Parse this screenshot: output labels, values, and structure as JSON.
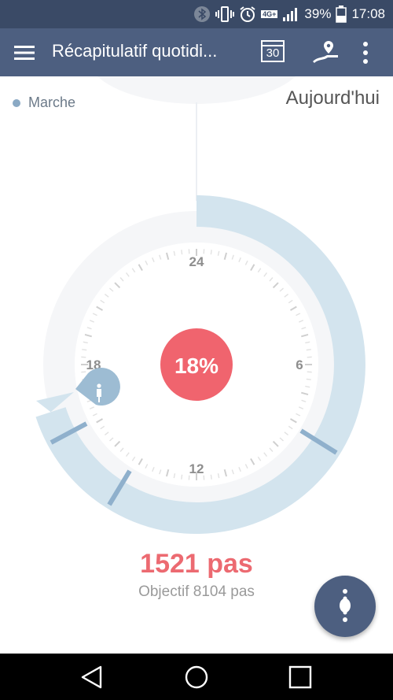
{
  "status_bar": {
    "network": "4G+",
    "battery": "39%",
    "time": "17:08",
    "icons": [
      "bluetooth-icon",
      "vibrate-icon",
      "alarm-icon",
      "signal-icon",
      "battery-icon"
    ]
  },
  "app_bar": {
    "title": "Récapitulatif quotidi...",
    "calendar_day": "30",
    "icons": [
      "menu-icon",
      "calendar-icon",
      "route-icon",
      "more-vert-icon"
    ]
  },
  "legend": {
    "label": "Marche",
    "color": "#8aa9c4"
  },
  "period": "Aujourd'hui",
  "dial": {
    "percent": "18%",
    "hour_labels": [
      "24",
      "6",
      "12",
      "18"
    ],
    "accent_color": "#f0646e",
    "ring_color": "#d3e4ee",
    "activity_marker_color": "#8fb0cc"
  },
  "summary": {
    "steps": "1521 pas",
    "goal": "Objectif 8104 pas"
  },
  "fab": {
    "icon": "walker-menu-icon"
  },
  "nav": [
    "back-icon",
    "home-icon",
    "recents-icon"
  ]
}
